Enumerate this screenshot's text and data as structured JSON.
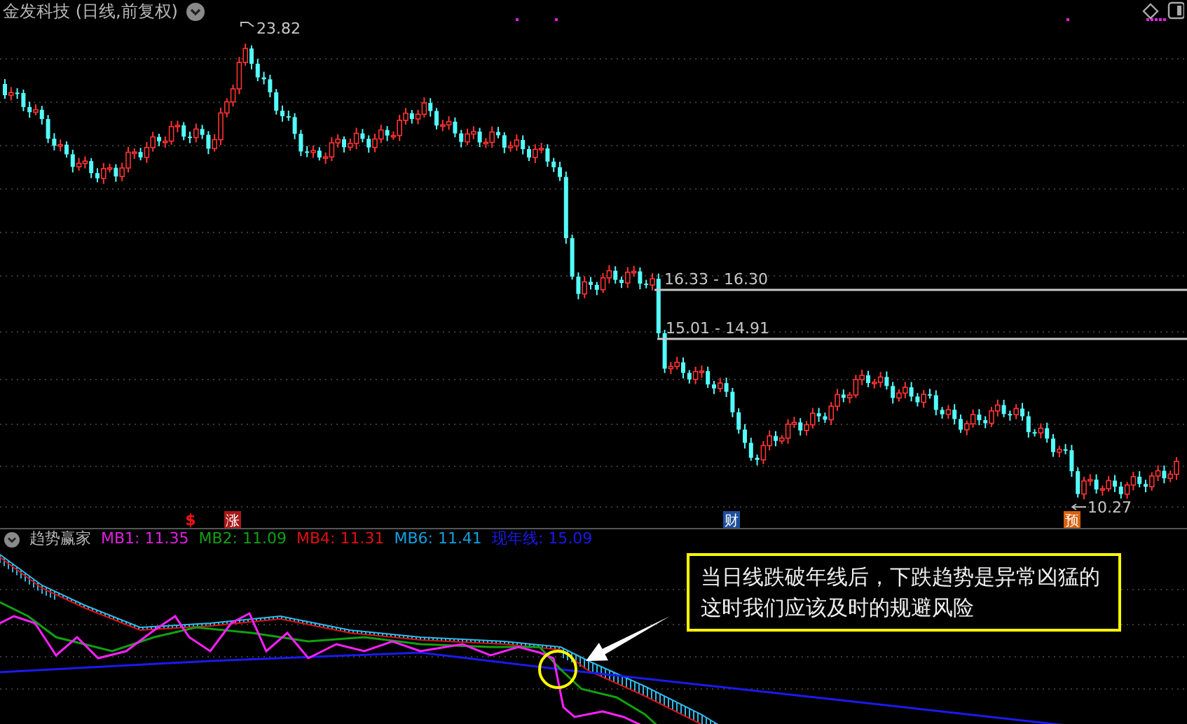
{
  "header": {
    "title": "金发科技 (日线,前复权)"
  },
  "price_labels": [
    {
      "text": "23.82",
      "kind": "high"
    },
    {
      "text": "16.33 - 16.30",
      "kind": "gap"
    },
    {
      "text": "15.01 - 14.91",
      "kind": "gap"
    },
    {
      "text": "10.27",
      "kind": "low"
    }
  ],
  "markers": [
    {
      "label": "$",
      "kind": "text",
      "color": "#ff1010"
    },
    {
      "label": "涨",
      "kind": "badge",
      "color": "#a81818"
    },
    {
      "label": "财",
      "kind": "badge",
      "color": "#1e4f9a"
    },
    {
      "label": "预",
      "kind": "badge",
      "color": "#d8600e"
    }
  ],
  "indicator": {
    "name": "趋势赢家",
    "values": [
      {
        "label": "MB1: 11.35",
        "color": "#e020e0"
      },
      {
        "label": "MB2: 11.09",
        "color": "#10a010"
      },
      {
        "label": "MB4: 11.31",
        "color": "#e01010"
      },
      {
        "label": "MB6: 11.41",
        "color": "#10a0e0"
      },
      {
        "label": "现年线: 15.09",
        "color": "#1a1af0"
      }
    ]
  },
  "annotation": {
    "lines": [
      "当日线跌破年线后，下跌趋势是异常凶猛的",
      "这时我们应该及时的规避风险"
    ]
  }
}
